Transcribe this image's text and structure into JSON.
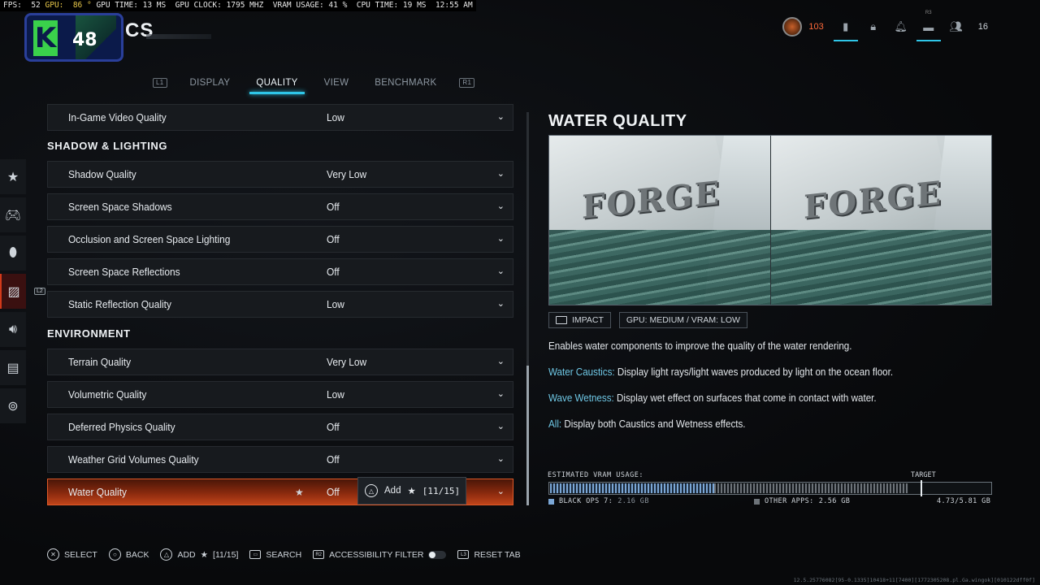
{
  "perf_overlay": {
    "fps": "FPS:  52",
    "gpu": "GPU:  86 °",
    "rest": "GPU TIME: 13 MS  GPU CLOCK: 1795 MHZ  VRAM USAGE: 41 %  CPU TIME: 19 MS  12:55 AM"
  },
  "header": {
    "logo_letter": "K",
    "logo_number": "48",
    "title_fragment": "CS"
  },
  "status_bar": {
    "currency_count": "103",
    "player_count": "16",
    "icons": [
      "emblem-icon",
      "options-icon",
      "lock-icon",
      "notification-icon",
      "r3-social-icon",
      "party-icon"
    ],
    "r3_label": "R3"
  },
  "tabs": {
    "left_bumper": "L1",
    "right_bumper": "R1",
    "items": [
      {
        "label": "DISPLAY",
        "active": false
      },
      {
        "label": "QUALITY",
        "active": true
      },
      {
        "label": "VIEW",
        "active": false
      },
      {
        "label": "BENCHMARK",
        "active": false
      }
    ]
  },
  "rail": {
    "l2_tag": "L2",
    "items": [
      "favorites-star-icon",
      "controller-icon",
      "mouse-icon",
      "graphics-icon",
      "audio-icon",
      "interface-icon",
      "network-icon"
    ]
  },
  "settings": {
    "top_row": {
      "label": "In-Game Video Quality",
      "value": "Low"
    },
    "section_shadow": "SHADOW & LIGHTING",
    "shadow_rows": [
      {
        "label": "Shadow Quality",
        "value": "Very Low"
      },
      {
        "label": "Screen Space Shadows",
        "value": "Off"
      },
      {
        "label": "Occlusion and Screen Space Lighting",
        "value": "Off"
      },
      {
        "label": "Screen Space Reflections",
        "value": "Off"
      },
      {
        "label": "Static Reflection Quality",
        "value": "Low"
      }
    ],
    "section_environment": "ENVIRONMENT",
    "env_rows": [
      {
        "label": "Terrain Quality",
        "value": "Very Low"
      },
      {
        "label": "Volumetric Quality",
        "value": "Low"
      },
      {
        "label": "Deferred Physics Quality",
        "value": "Off"
      },
      {
        "label": "Weather Grid Volumes Quality",
        "value": "Off"
      }
    ],
    "selected_row": {
      "label": "Water Quality",
      "value": "Off"
    }
  },
  "add_tooltip": {
    "label": "Add",
    "count": "[11/15]"
  },
  "detail": {
    "title": "WATER QUALITY",
    "preview_word_left": "FORGE",
    "preview_word_right": "FORGE",
    "impact_label": "IMPACT",
    "impact_value": "GPU: MEDIUM  /  VRAM: LOW",
    "description": "Enables water components to improve the quality of the water rendering.",
    "options": [
      {
        "key": "Water Caustics:",
        "text": " Display light rays/light waves produced by light on the ocean floor."
      },
      {
        "key": "Wave Wetness:",
        "text": " Display wet effect on surfaces that come in contact with water."
      },
      {
        "key": "All:",
        "text": " Display both Caustics and Wetness effects."
      }
    ]
  },
  "vram": {
    "label": "ESTIMATED VRAM USAGE:",
    "target_label": "TARGET",
    "game_name": "BLACK OPS 7:",
    "game_value": "2.16 GB",
    "other_name": "OTHER APPS:",
    "other_value": "2.56 GB",
    "total": "4.73/5.81 GB",
    "game_fraction": 0.372,
    "other_fraction": 0.44,
    "target_fraction": 0.84,
    "game_color": "#7ba7d6",
    "other_color": "#6d7379"
  },
  "hints": {
    "select": "SELECT",
    "back": "BACK",
    "add": "ADD",
    "add_count": "[11/15]",
    "search": "SEARCH",
    "r2_tag": "R2",
    "accessibility": "ACCESSIBILITY FILTER",
    "l3_tag": "L3",
    "reset": "RESET TAB"
  },
  "build_string": "12.5.25776082[95-0.1335]10418+11[7400][1772305208.pl.Ga.wingok][010122dff0f]",
  "colors": {
    "accent_cyan": "#2fc6e8",
    "selected_orange": "#c0441a",
    "highlight_key": "#6fc8e6",
    "currency_orange": "#ff6a3a"
  }
}
